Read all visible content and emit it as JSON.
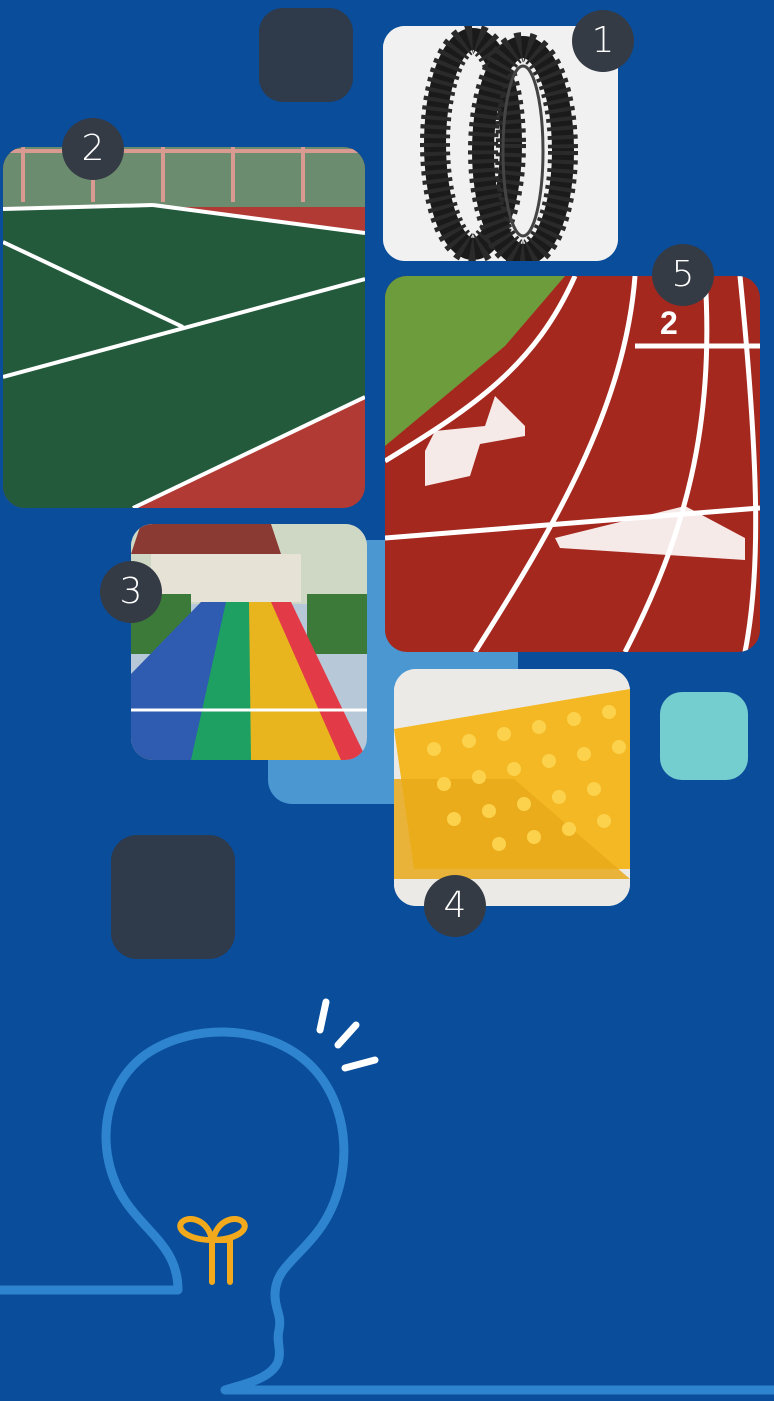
{
  "colors": {
    "background": "#094d9b",
    "dark_square": "#2f3a4a",
    "light_blue_panel": "#4a97d2",
    "teal_square": "#74cdcf",
    "badge_bg": "#353b45",
    "bulb_outline": "#2f84cf",
    "bulb_filament": "#f2a91b"
  },
  "tiles": [
    {
      "badge": "1",
      "subject": "tyres"
    },
    {
      "badge": "2",
      "subject": "court"
    },
    {
      "badge": "3",
      "subject": "colored-lanes"
    },
    {
      "badge": "4",
      "subject": "tactile-tiles"
    },
    {
      "badge": "5",
      "subject": "running-track"
    }
  ],
  "decor": {
    "icons": [
      "lightbulb-icon",
      "spark-lines-icon"
    ]
  }
}
